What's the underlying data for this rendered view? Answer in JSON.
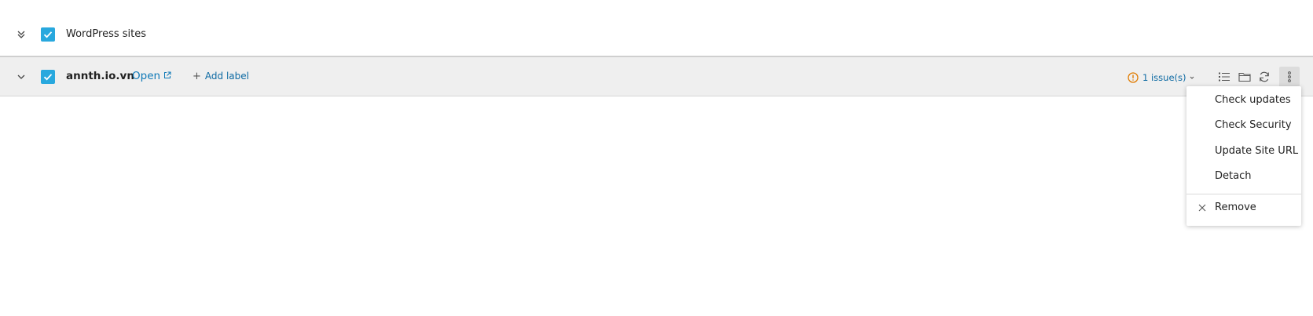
{
  "header": {
    "title": "WordPress sites"
  },
  "site": {
    "name": "annth.io.vn",
    "open_label": "Open",
    "add_label": "Add label",
    "issues_label": "1 issue(s)"
  },
  "menu": {
    "items": [
      {
        "label": "Check updates"
      },
      {
        "label": "Check Security"
      },
      {
        "label": "Update Site URL"
      },
      {
        "label": "Detach"
      }
    ],
    "remove_label": "Remove"
  },
  "colors": {
    "accent": "#28a8de",
    "link": "#0d78b7",
    "warning": "#e07b00",
    "row_bg": "#efefef"
  },
  "icons": {
    "collapse_all": "double-chevron-down-icon",
    "row_toggle": "chevron-down-icon",
    "external_link": "external-link-icon",
    "warning": "warning-circle-icon",
    "list": "list-icon",
    "folder": "folder-icon",
    "sync": "sync-icon",
    "more": "more-vertical-icon",
    "remove": "close-icon"
  }
}
